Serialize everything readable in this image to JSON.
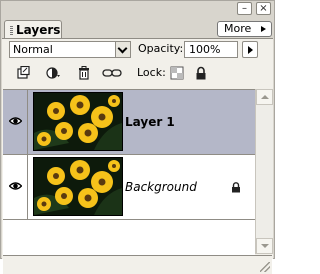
{
  "window": {
    "minimize_glyph": "–",
    "close_glyph": "×"
  },
  "tab": {
    "label": "Layers"
  },
  "menu": {
    "more_label": "More"
  },
  "controls": {
    "blend_mode": "Normal",
    "opacity_label": "Opacity:",
    "opacity_value": "100%",
    "lock_label": "Lock:"
  },
  "toolbar_icons": [
    "new-layer-icon",
    "adjustment-layer-icon",
    "trash-icon",
    "link-icon",
    "lock-transparency-icon",
    "lock-all-icon"
  ],
  "layers": [
    {
      "name": "Layer 1",
      "selected": true,
      "visible": true,
      "locked": false
    },
    {
      "name": "Background",
      "selected": false,
      "visible": true,
      "locked": true
    }
  ],
  "colors": {
    "panel_bg": "#d8d5cd",
    "body_bg": "#f2f0ea",
    "selected_row": "#b4b7c8",
    "flower_yellow": "#f6c21a",
    "flower_center": "#5a3a10"
  }
}
